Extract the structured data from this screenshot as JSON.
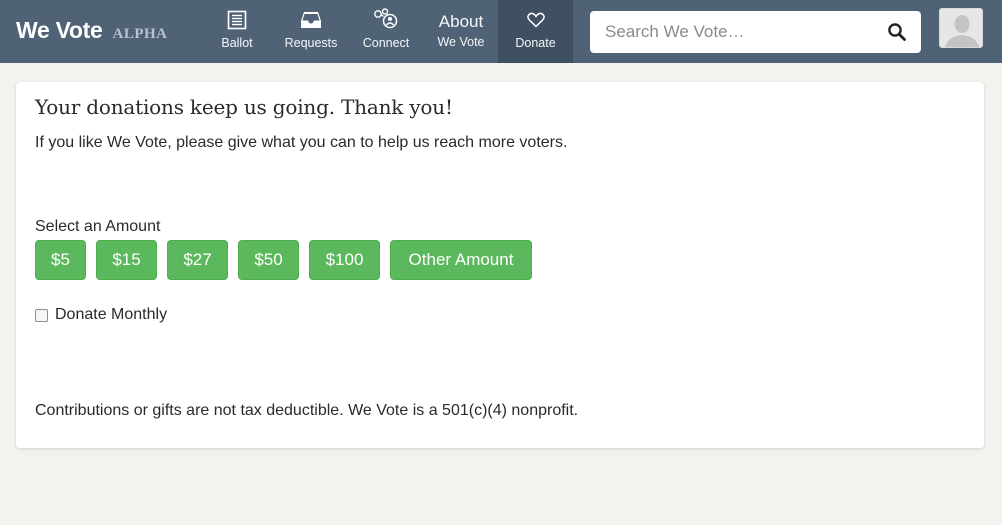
{
  "header": {
    "brand_name": "We Vote",
    "brand_tag": "ALPHA",
    "nav": {
      "ballot": "Ballot",
      "requests": "Requests",
      "connect": "Connect",
      "about_top": "About",
      "about_bottom": "We Vote",
      "donate": "Donate"
    },
    "search_placeholder": "Search We Vote…"
  },
  "donate": {
    "title": "Your donations keep us going. Thank you!",
    "subtitle": "If you like We Vote, please give what you can to help us reach more voters.",
    "amount_label": "Select an Amount",
    "amounts": [
      "$5",
      "$15",
      "$27",
      "$50",
      "$100",
      "Other Amount"
    ],
    "monthly_label": "Donate Monthly",
    "footnote": "Contributions or gifts are not tax deductible. We Vote is a 501(c)(4) nonprofit."
  },
  "colors": {
    "header_bg": "#4f6276",
    "active_nav_bg": "#3f5062",
    "button_green": "#5cb85c",
    "page_bg": "#f3f2ef"
  },
  "icons": {
    "ballot": "ballot-list-icon",
    "requests": "inbox-tray-icon",
    "connect": "people-network-icon",
    "donate": "heart-outline-icon",
    "search": "magnifier-icon",
    "avatar": "user-silhouette-icon"
  }
}
